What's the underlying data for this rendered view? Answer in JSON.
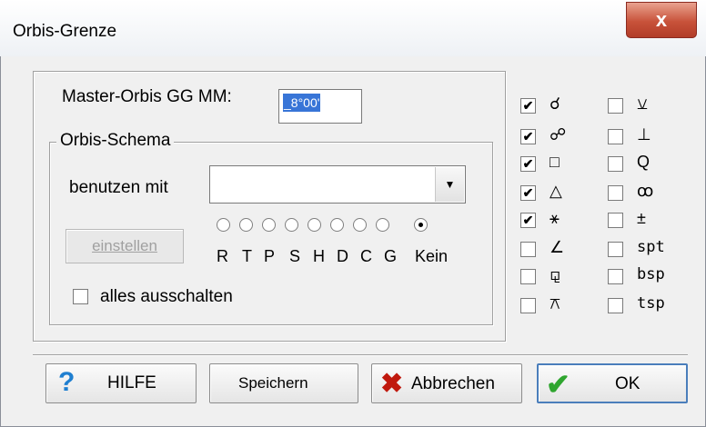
{
  "window": {
    "title": "Orbis-Grenze",
    "close_label": "x"
  },
  "master": {
    "label": "Master-Orbis GG MM:",
    "value": "_8°00'"
  },
  "schema": {
    "legend": "Orbis-Schema",
    "benutzen_label": "benutzen mit",
    "benutzen_value": "",
    "einstellen_label": "einstellen",
    "radio_letters": [
      "R",
      "T",
      "P",
      "S",
      "H",
      "D",
      "C",
      "G",
      "Kein"
    ],
    "selected_radio": "Kein",
    "alles_label": "alles ausschalten",
    "alles_checked": false
  },
  "aspects_left": [
    {
      "symbol": "☌",
      "checked": true
    },
    {
      "symbol": "☍",
      "checked": true
    },
    {
      "symbol": "□",
      "checked": true
    },
    {
      "symbol": "△",
      "checked": true
    },
    {
      "symbol": "⚹",
      "checked": true
    },
    {
      "symbol": "∠",
      "checked": false
    },
    {
      "symbol": "⚼",
      "checked": false
    },
    {
      "symbol": "⚻",
      "checked": false
    }
  ],
  "aspects_right": [
    {
      "symbol": "⚺",
      "checked": false
    },
    {
      "symbol": "⊥",
      "checked": false
    },
    {
      "symbol": "Q",
      "checked": false
    },
    {
      "symbol": "ꝏ",
      "checked": false
    },
    {
      "symbol": "±",
      "checked": false
    },
    {
      "symbol": "spt",
      "checked": false
    },
    {
      "symbol": "bsp",
      "checked": false
    },
    {
      "symbol": "tsp",
      "checked": false
    }
  ],
  "buttons": {
    "help": "HILFE",
    "save": "Speichern",
    "cancel": "Abbrechen",
    "ok": "OK"
  },
  "colors": {
    "help_icon": "#1f7fd0",
    "cancel_icon": "#c0190e",
    "ok_icon": "#2fa52f"
  }
}
